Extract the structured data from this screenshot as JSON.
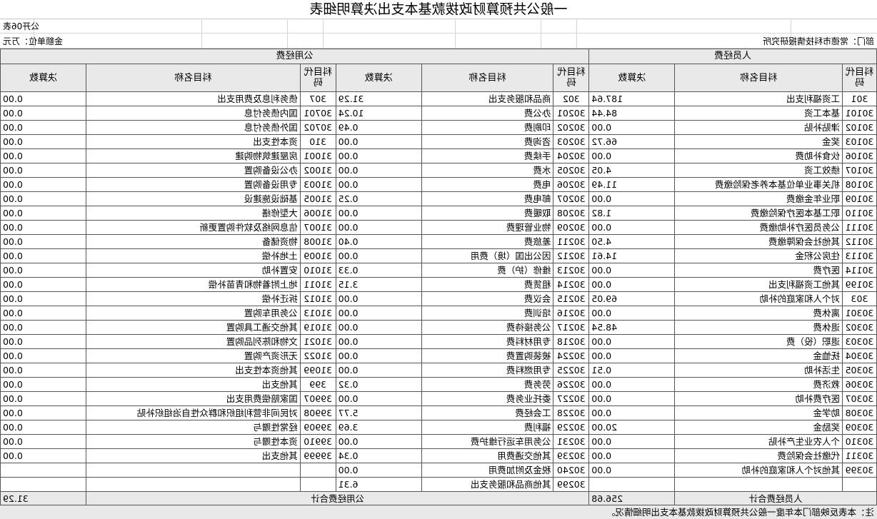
{
  "title": "一般公共预算财政拨款基本支出决算明细表",
  "table_no": "公开06表",
  "department": "部门：常德市科技情报研究所",
  "unit": "金额单位：万元",
  "group_personnel": "人员经费",
  "group_public": "公用经费",
  "headers": {
    "code": "科目代码",
    "name": "科目名称",
    "amount": "决算数"
  },
  "rows": [
    [
      "301",
      "工资福利支出",
      "187.64",
      "302",
      "商品和服务支出",
      "31.29",
      "307",
      "债务利息及费用支出",
      "0.00"
    ],
    [
      "30101",
      "基本工资",
      "84.44",
      "30201",
      "办公费",
      "10.24",
      "30701",
      "国内债务付息",
      "0.00"
    ],
    [
      "30102",
      "津贴补贴",
      "0.00",
      "30202",
      "印刷费",
      "0.49",
      "30702",
      "国外债务付息",
      "0.00"
    ],
    [
      "30103",
      "奖金",
      "66.72",
      "30203",
      "咨询费",
      "0.00",
      "310",
      "资本性支出",
      "0.00"
    ],
    [
      "30106",
      "伙食补助费",
      "0.00",
      "30204",
      "手续费",
      "0.00",
      "31001",
      "房屋建筑物购建",
      "0.00"
    ],
    [
      "30107",
      "绩效工资",
      "4.05",
      "30205",
      "水费",
      "0.00",
      "31002",
      "办公设备购置",
      "0.00"
    ],
    [
      "30108",
      "机关事业单位基本养老保险缴费",
      "11.49",
      "30206",
      "电费",
      "0.00",
      "31003",
      "专用设备购置",
      "0.00"
    ],
    [
      "30109",
      "职业年金缴费",
      "0.00",
      "30207",
      "邮电费",
      "0.25",
      "31005",
      "基础设施建设",
      "0.00"
    ],
    [
      "30110",
      "职工基本医疗保险缴费",
      "1.82",
      "30208",
      "取暖费",
      "0.00",
      "31006",
      "大型修缮",
      "0.00"
    ],
    [
      "30111",
      "公务员医疗补助缴费",
      "0.00",
      "30209",
      "物业管理费",
      "0.00",
      "31007",
      "信息网络及软件购置更新",
      "0.00"
    ],
    [
      "30112",
      "其他社会保障缴费",
      "4.50",
      "30211",
      "差旅费",
      "0.40",
      "31008",
      "物资储备",
      "0.00"
    ],
    [
      "30113",
      "住房公积金",
      "14.61",
      "30212",
      "因公出国（境）费用",
      "0.00",
      "31009",
      "土地补偿",
      "0.00"
    ],
    [
      "30114",
      "医疗费",
      "0.00",
      "30213",
      "维修（护）费",
      "0.33",
      "31010",
      "安置补助",
      "0.00"
    ],
    [
      "30199",
      "其他工资福利支出",
      "0.00",
      "30214",
      "租赁费",
      "3.15",
      "31011",
      "地上附着物和青苗补偿",
      "0.00"
    ],
    [
      "303",
      "对个人和家庭的补助",
      "69.05",
      "30215",
      "会议费",
      "0.00",
      "31012",
      "拆迁补偿",
      "0.00"
    ],
    [
      "30301",
      "离休费",
      "0.00",
      "30216",
      "培训费",
      "0.00",
      "31013",
      "公务用车购置",
      "0.00"
    ],
    [
      "30302",
      "退休费",
      "48.54",
      "30217",
      "公务接待费",
      "0.00",
      "31019",
      "其他交通工具购置",
      "0.00"
    ],
    [
      "30303",
      "退职（役）费",
      "0.00",
      "30218",
      "专用材料费",
      "0.00",
      "31021",
      "文物和陈列品购置",
      "0.00"
    ],
    [
      "30304",
      "抚恤金",
      "0.00",
      "30224",
      "被装购置费",
      "0.00",
      "31022",
      "无形资产购置",
      "0.00"
    ],
    [
      "30305",
      "生活补助",
      "0.51",
      "30225",
      "专用燃料费",
      "0.00",
      "31099",
      "其他资本性支出",
      "0.00"
    ],
    [
      "30306",
      "救济费",
      "0.00",
      "30226",
      "劳务费",
      "0.32",
      "399",
      "其他支出",
      "0.00"
    ],
    [
      "30307",
      "医疗费补助",
      "0.00",
      "30227",
      "委托业务费",
      "0.00",
      "39907",
      "国家赔偿费用支出",
      "0.00"
    ],
    [
      "30308",
      "助学金",
      "0.00",
      "30228",
      "工会经费",
      "5.77",
      "39908",
      "对民间非营利组织和群众性自治组织补贴",
      "0.00"
    ],
    [
      "30309",
      "奖励金",
      "20.00",
      "30229",
      "福利费",
      "3.69",
      "39909",
      "经常性赠与",
      "0.00"
    ],
    [
      "30310",
      "个人农业生产补贴",
      "0.00",
      "30231",
      "公务用车运行维护费",
      "0.00",
      "39910",
      "资本性赠与",
      "0.00"
    ],
    [
      "30311",
      "代缴社会保险费",
      "0.00",
      "30239",
      "其他交通费用",
      "0.34",
      "39999",
      "其他支出",
      "0.00"
    ],
    [
      "30399",
      "其他对个人和家庭的补助",
      "0.00",
      "30240",
      "税金及附加费用",
      "0.00",
      "",
      "",
      " "
    ],
    [
      "",
      "",
      "",
      "30299",
      "其他商品和服务支出",
      "6.31",
      "",
      "",
      " "
    ]
  ],
  "totals": {
    "personnel_label": "人员经费合计",
    "personnel_value": "256.68",
    "public_label": "公用经费合计",
    "public_value": "31.29"
  },
  "note": "注：本表反映部门本年度一般公共预算财政拨款基本支出明细情况。"
}
